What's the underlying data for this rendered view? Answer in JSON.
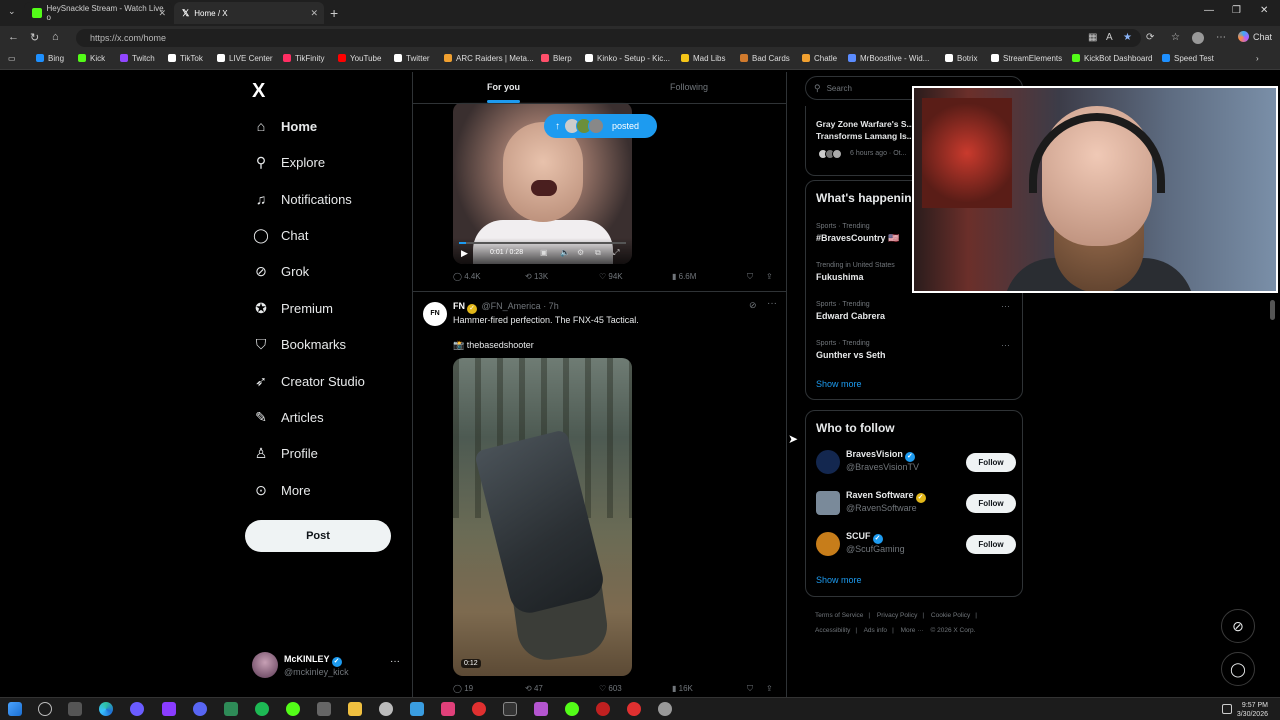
{
  "browser": {
    "tabs": [
      {
        "label": "HeySnackle Stream - Watch Live o",
        "color": "#53fc18"
      },
      {
        "label": "Home / X",
        "color": "#ffffff"
      }
    ],
    "url": "https://x.com/home",
    "chat_label": "Chat",
    "bookmarks": [
      {
        "label": "Bing",
        "color": "#1e90ff"
      },
      {
        "label": "Kick",
        "color": "#53fc18"
      },
      {
        "label": "Twitch",
        "color": "#9146ff"
      },
      {
        "label": "TikTok",
        "color": "#ffffff"
      },
      {
        "label": "LIVE Center",
        "color": "#ffffff"
      },
      {
        "label": "TikFinity",
        "color": "#ff2e63"
      },
      {
        "label": "YouTube",
        "color": "#ff0000"
      },
      {
        "label": "Twitter",
        "color": "#ffffff"
      },
      {
        "label": "ARC Raiders | Meta...",
        "color": "#f0a030"
      },
      {
        "label": "Blerp",
        "color": "#ff4f6a"
      },
      {
        "label": "Kinko - Setup - Kic...",
        "color": "#ffffff"
      },
      {
        "label": "Mad Libs",
        "color": "#f5c518"
      },
      {
        "label": "Bad Cards",
        "color": "#d07a2d"
      },
      {
        "label": "Chatle",
        "color": "#f0a030"
      },
      {
        "label": "MrBoostlive - Wid...",
        "color": "#5b8cff"
      },
      {
        "label": "Botrix",
        "color": "#ffffff"
      },
      {
        "label": "StreamElements",
        "color": "#ffffff"
      },
      {
        "label": "KickBot Dashboard",
        "color": "#53fc18"
      },
      {
        "label": "Speed Test",
        "color": "#1e90ff"
      }
    ]
  },
  "nav": {
    "logo": "X",
    "items": [
      {
        "label": "Home",
        "icon": "home-icon",
        "glyph": "⌂"
      },
      {
        "label": "Explore",
        "icon": "search-icon",
        "glyph": "⚲"
      },
      {
        "label": "Notifications",
        "icon": "bell-icon",
        "glyph": "🔔"
      },
      {
        "label": "Chat",
        "icon": "chat-icon",
        "glyph": "💬"
      },
      {
        "label": "Grok",
        "icon": "grok-icon",
        "glyph": "⊘"
      },
      {
        "label": "Premium",
        "icon": "premium-icon",
        "glyph": "✪"
      },
      {
        "label": "Bookmarks",
        "icon": "bookmark-icon",
        "glyph": "🔖"
      },
      {
        "label": "Creator Studio",
        "icon": "rocket-icon",
        "glyph": "🚀"
      },
      {
        "label": "Articles",
        "icon": "articles-icon",
        "glyph": "✎"
      },
      {
        "label": "Profile",
        "icon": "person-icon",
        "glyph": "👤"
      },
      {
        "label": "More",
        "icon": "more-circle-icon",
        "glyph": "⋯"
      }
    ],
    "post_label": "Post",
    "account": {
      "name": "McKINLEY",
      "handle": "@mckinley_kick"
    }
  },
  "timeline": {
    "tabs": {
      "foryou": "For you",
      "following": "Following"
    },
    "posted_pill": "posted",
    "tweet1": {
      "video_time": "0:01 / 0:28",
      "replies": "4.4K",
      "reposts": "13K",
      "likes": "94K",
      "views": "6.6M"
    },
    "tweet2": {
      "name": "FN",
      "handle": "@FN_America",
      "time": "· 7h",
      "text": "Hammer-fired perfection. The FNX-45 Tactical.",
      "credit": "📸 thebasedshooter",
      "duration": "0:12",
      "replies": "19",
      "reposts": "47",
      "likes": "603",
      "views": "16K"
    }
  },
  "sidebar": {
    "search_placeholder": "Search",
    "news": {
      "title": "Gray Zone Warfare's S... Transforms Lamang Is...",
      "meta": "6 hours ago · Ot..."
    },
    "trending_title": "What's happenin...",
    "trends": [
      {
        "context": "Sports · Trending",
        "name": "#BravesCountry 🇺🇸"
      },
      {
        "context": "Trending in United States",
        "name": "Fukushima"
      },
      {
        "context": "Sports · Trending",
        "name": "Edward Cabrera"
      },
      {
        "context": "Sports · Trending",
        "name": "Gunther vs Seth"
      }
    ],
    "show_more": "Show more",
    "follow_title": "Who to follow",
    "follow": [
      {
        "name": "BravesVision",
        "handle": "@BravesVisionTV",
        "badge": "blue",
        "button": "Follow",
        "color": "#13274f"
      },
      {
        "name": "Raven Software",
        "handle": "@RavenSoftware",
        "badge": "gold",
        "button": "Follow",
        "color": "#7a8a9a"
      },
      {
        "name": "SCUF",
        "handle": "@ScufGaming",
        "badge": "blue",
        "button": "Follow",
        "color": "#c77d1a"
      }
    ],
    "footer": [
      "Terms of Service",
      "|",
      "Privacy Policy",
      "|",
      "Cookie Policy",
      "|",
      "Accessibility",
      "|",
      "Ads info",
      "|",
      "More ···",
      "© 2026 X Corp."
    ]
  },
  "taskbar": {
    "time": "9:57 PM",
    "date": "3/30/2026"
  }
}
